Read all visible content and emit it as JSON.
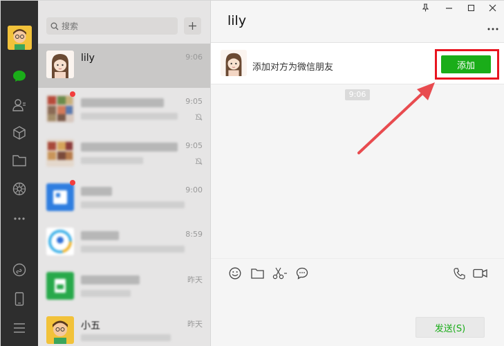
{
  "search": {
    "placeholder": "搜索"
  },
  "sessions": [
    {
      "name": "lily",
      "time": "9:06",
      "active": true
    },
    {
      "name": "",
      "time": "9:05"
    },
    {
      "name": "",
      "time": "9:05"
    },
    {
      "name": "",
      "time": "9:00"
    },
    {
      "name": "",
      "time": "8:59"
    },
    {
      "name": "",
      "time": "昨天"
    },
    {
      "name": "小五",
      "time": "昨天"
    }
  ],
  "chat": {
    "title": "lily",
    "notice_text": "添加对方为微信朋友",
    "add_label": "添加",
    "timestamp": "9:06",
    "send_label": "发送(S)"
  },
  "colors": {
    "accent": "#1aad19",
    "highlight": "#e8141f",
    "badge": "#f23d3d"
  }
}
